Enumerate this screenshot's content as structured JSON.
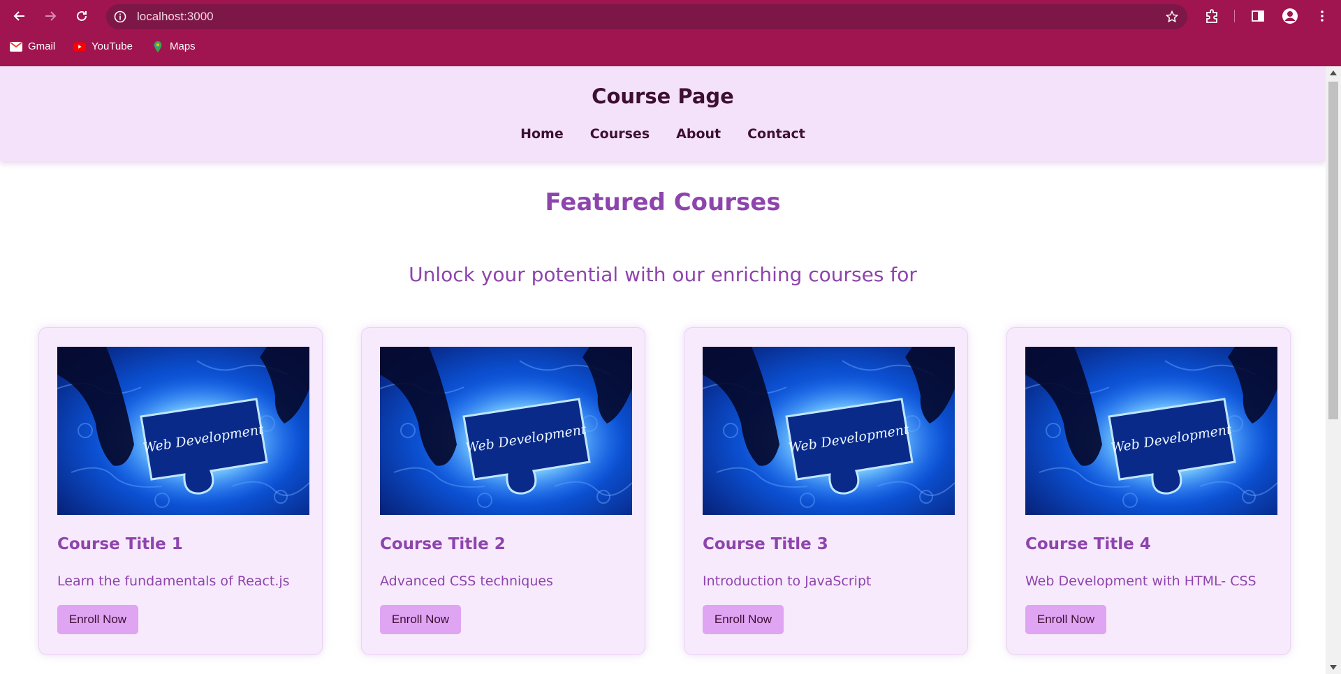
{
  "browser": {
    "url": "localhost:3000",
    "bookmarks": [
      {
        "label": "Gmail",
        "icon": "gmail-icon"
      },
      {
        "label": "YouTube",
        "icon": "youtube-icon"
      },
      {
        "label": "Maps",
        "icon": "maps-icon"
      }
    ],
    "colors": {
      "frame": "#a0144f",
      "omnibox": "#7d1747"
    }
  },
  "header": {
    "title": "Course Page",
    "nav": [
      "Home",
      "Courses",
      "About",
      "Contact"
    ]
  },
  "featured": {
    "title": "Featured Courses",
    "subtitle": "Unlock your potential with our enriching courses for"
  },
  "courses": [
    {
      "title": "Course Title 1",
      "description": "Learn the fundamentals of React.js",
      "button": "Enroll Now",
      "image_text": "Web Development"
    },
    {
      "title": "Course Title 2",
      "description": "Advanced CSS techniques",
      "button": "Enroll Now",
      "image_text": "Web Development"
    },
    {
      "title": "Course Title 3",
      "description": "Introduction to JavaScript",
      "button": "Enroll Now",
      "image_text": "Web Development"
    },
    {
      "title": "Course Title 4",
      "description": "Web Development with HTML- CSS",
      "button": "Enroll Now",
      "image_text": "Web Development"
    }
  ],
  "theme": {
    "accent": "#8e44ad",
    "header_bg": "#f4e2fa",
    "card_bg": "#f7eafc",
    "button_bg": "#dfa4f2"
  }
}
